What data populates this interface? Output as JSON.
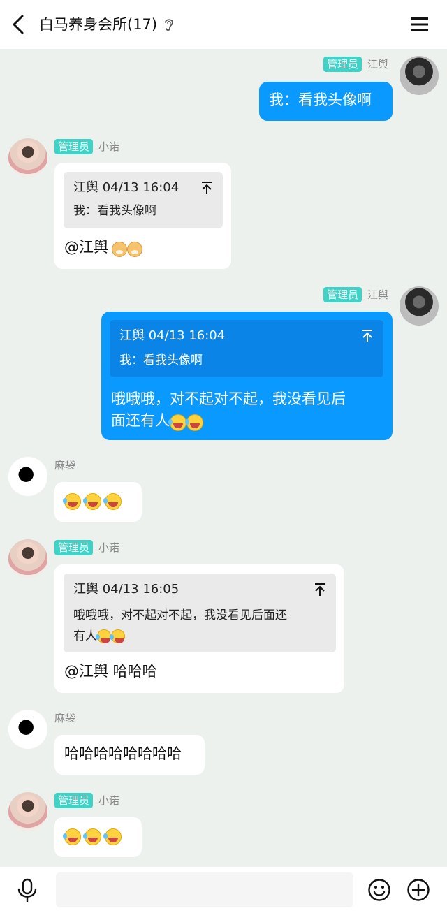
{
  "header": {
    "title": "白马养身会所(17)",
    "back_icon": "chevron-left-icon",
    "ear_icon": "ear-icon",
    "menu_icon": "hamburger-menu-icon"
  },
  "messages": [
    {
      "sender": "江舆",
      "badge": "管理员",
      "side": "right",
      "text": "我：看我头像啊"
    },
    {
      "sender": "小诺",
      "badge": "管理员",
      "side": "left",
      "quote": {
        "header": "江舆 04/13 16:04",
        "body": "我：看我头像啊"
      },
      "text": "@江舆"
    },
    {
      "sender": "江舆",
      "badge": "管理员",
      "side": "right",
      "quote": {
        "header": "江舆 04/13 16:04",
        "body": "我：看我头像啊"
      },
      "text_line1": "哦哦哦，对不起对不起，我没看见后",
      "text_line2": "面还有人"
    },
    {
      "sender": "麻袋",
      "side": "left"
    },
    {
      "sender": "小诺",
      "badge": "管理员",
      "side": "left",
      "quote": {
        "header": "江舆 04/13 16:05",
        "body_line1": "哦哦哦，对不起对不起，我没看见后面还",
        "body_line2": "有人"
      },
      "text": "@江舆 哈哈哈"
    },
    {
      "sender": "麻袋",
      "side": "left",
      "text": "哈哈哈哈哈哈哈哈"
    },
    {
      "sender": "小诺",
      "badge": "管理员",
      "side": "left"
    }
  ],
  "bottom": {
    "input_placeholder": "",
    "mic_icon": "microphone-icon",
    "emoji_icon": "smiley-icon",
    "plus_icon": "plus-circle-icon"
  },
  "colors": {
    "background": "#edf1ee",
    "bubble_blue": "#0a99ff",
    "badge_teal": "#3fd2c7"
  }
}
